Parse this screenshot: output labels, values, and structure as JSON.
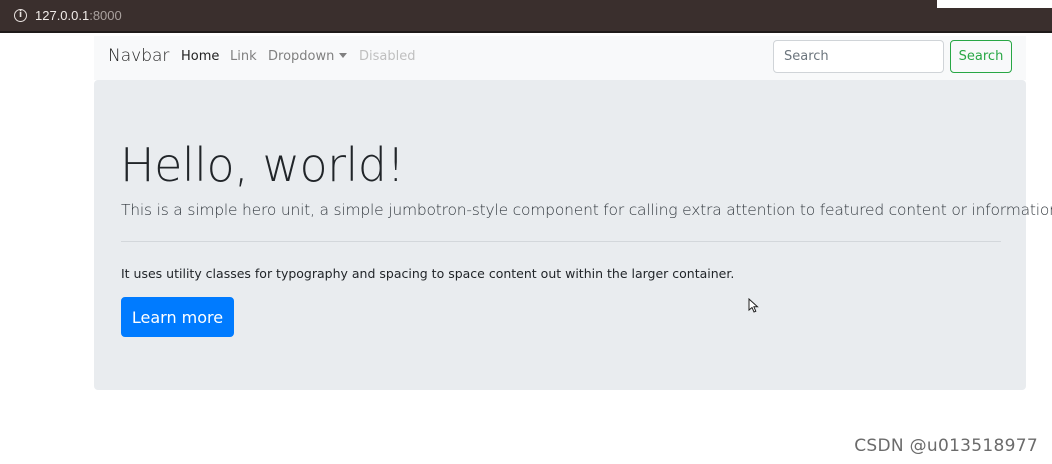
{
  "browser": {
    "url_host": "127.0.0.1",
    "url_port": ":8000",
    "info_icon": "info-icon"
  },
  "navbar": {
    "brand": "Navbar",
    "links": {
      "home": "Home",
      "link": "Link",
      "dropdown": "Dropdown",
      "disabled": "Disabled"
    },
    "search_placeholder": "Search",
    "search_button": "Search"
  },
  "jumbotron": {
    "title": "Hello, world!",
    "lead": "This is a simple hero unit, a simple jumbotron-style component for calling extra attention to featured content or information.",
    "body": "It uses utility classes for typography and spacing to space content out within the larger container.",
    "button": "Learn more"
  },
  "watermark": "CSDN @u013518977",
  "colors": {
    "primary": "#007bff",
    "success": "#28a745",
    "jumbotron_bg": "#e9ecef",
    "navbar_bg": "#f8f9fa"
  }
}
